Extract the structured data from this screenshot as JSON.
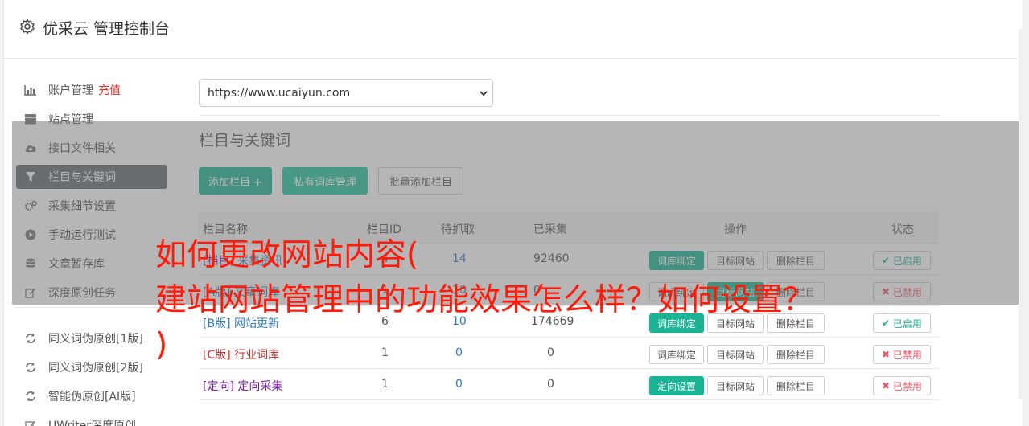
{
  "header": {
    "title": "优采云 管理控制台"
  },
  "sidebar": {
    "items": [
      {
        "label": "账户管理",
        "extra": "充值",
        "icon": "bar-chart-icon"
      },
      {
        "label": "站点管理",
        "icon": "server-icon"
      },
      {
        "label": "接口文件相关",
        "icon": "cloud-upload-icon"
      },
      {
        "label": "栏目与关键词",
        "icon": "filter-icon",
        "active": true
      },
      {
        "label": "采集细节设置",
        "icon": "cogs-icon"
      },
      {
        "label": "手动运行测试",
        "icon": "play-circle-icon"
      },
      {
        "label": "文章暂存库",
        "icon": "database-icon"
      },
      {
        "label": "深度原创任务",
        "icon": "edit-icon"
      },
      {
        "label": "同义词伪原创[1版]",
        "icon": "refresh-icon"
      },
      {
        "label": "同义词伪原创[2版]",
        "icon": "refresh-icon"
      },
      {
        "label": "智能伪原创[AI版]",
        "icon": "refresh-icon"
      },
      {
        "label": "UWriter深度原创",
        "icon": "edit-icon"
      }
    ]
  },
  "site_select": {
    "value": "https://www.ucaiyun.com"
  },
  "section": {
    "title": "栏目与关键词"
  },
  "toolbar": {
    "add_column": "添加栏目 +",
    "private_lexicon": "私有词库管理",
    "batch_add": "批量添加栏目"
  },
  "table": {
    "headers": [
      "栏目名称",
      "栏目ID",
      "待抓取",
      "已采集",
      "操作",
      "状态"
    ],
    "rows": [
      {
        "tag": "[档目]",
        "name": "采集资讯",
        "id": "4",
        "pending": "14",
        "collected": "92460",
        "action1": "词库绑定",
        "action2": "目标网站",
        "action3": "删除栏目",
        "status": "已启用",
        "enabled": true
      },
      {
        "tag": "[A版]",
        "name": "文章词库",
        "id": "1",
        "pending": "10",
        "collected": "0",
        "action1": "词库绑定",
        "action2": "目标网站",
        "action3": "删除栏目",
        "status": "已禁用",
        "enabled": false
      },
      {
        "tag": "[B版]",
        "name": "网站更新",
        "id": "6",
        "pending": "10",
        "collected": "174669",
        "action1": "词库绑定",
        "action2": "目标网站",
        "action3": "删除栏目",
        "status": "已启用",
        "enabled": true
      },
      {
        "tag": "[C版]",
        "name": "行业词库",
        "id": "1",
        "pending": "0",
        "collected": "0",
        "action1": "词库绑定",
        "action2": "目标网站",
        "action3": "删除栏目",
        "status": "已禁用",
        "enabled": false
      },
      {
        "tag": "[定向]",
        "name": "定向采集",
        "id": "1",
        "pending": "0",
        "collected": "0",
        "action1": "定向设置",
        "action2": "目标网站",
        "action3": "删除栏目",
        "status": "已禁用",
        "enabled": false
      }
    ]
  },
  "overlay_caption": {
    "line1": "如何更改网站内容(",
    "line2": "建站网站管理中的功能效果怎么样？如何设置？",
    "line3": ")"
  },
  "colors": {
    "accent": "#1ab394",
    "danger": "#ed5565",
    "caption": "#ff1a0a"
  }
}
